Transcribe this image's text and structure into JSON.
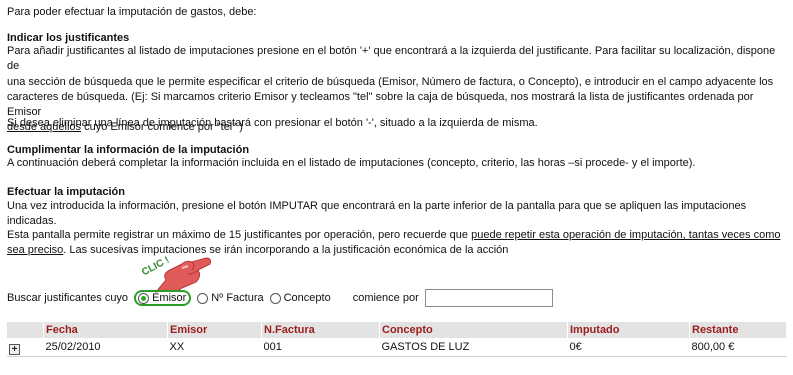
{
  "intro": "Para poder efectuar la imputación de gastos, debe:",
  "sections": {
    "indicar": {
      "heading": "Indicar los justificantes",
      "line1": "Para añadir justificantes al listado de imputaciones presione en el botón '+' que encontrará a la izquierda del justificante. Para facilitar su localización, dispone de",
      "line2": "una sección de búsqueda que le permite especificar el criterio de búsqueda (Emisor, Número de factura, o Concepto), e introducir en el campo adyacente los",
      "line3": "caracteres de búsqueda. (Ej: Si marcamos criterio Emisor y tecleamos \"tel\" sobre la caja de búsqueda, nos mostrará la lista de justificantes ordenada por Emisor",
      "line4_underlined": "desde aquellos",
      "line4_rest": " cuyo Emisor comience por \"tel\" )",
      "eliminar": "Si desea eliminar una línea de imputación bastará con presionar el botón '-', situado a la izquierda de misma."
    },
    "cumplimentar": {
      "heading": "Cumplimentar la información de la imputación",
      "text": "A continuación deberá completar la información incluida en el listado de imputaciones (concepto, criterio, las horas –si procede- y el importe)."
    },
    "efectuar": {
      "heading": "Efectuar la imputación",
      "text": "Una vez introducida la información, presione el botón IMPUTAR que encontrará en la parte inferior de la pantalla para que se apliquen las imputaciones indicadas."
    },
    "pantalla": {
      "line1_start": "Esta pantalla permite registrar un máximo de 15 justificantes por operación, pero recuerde que ",
      "line1_underlined": "puede repetir esta operación de imputación, tantas veces como",
      "line2_underlined": "sea preciso",
      "line2_rest": ". Las sucesivas imputaciones se irán incorporando a la justificación económica de la acción"
    }
  },
  "annotation": {
    "clic_label": "CLIC !",
    "colors": {
      "pointer": "#e05a5a",
      "label": "#2e8b2e"
    }
  },
  "search": {
    "label": "Buscar justificantes cuyo",
    "options": [
      "Emisor",
      "Nº Factura",
      "Concepto"
    ],
    "selected": "Emisor",
    "suffix_label": "comience por",
    "input_value": ""
  },
  "table": {
    "headers": [
      "",
      "Fecha",
      "Emisor",
      "N.Factura",
      "Concepto",
      "Imputado",
      "Restante"
    ],
    "rows": [
      {
        "add_icon": "+",
        "fecha": "25/02/2010",
        "emisor": "XX",
        "factura": "001",
        "concepto": "GASTOS DE LUZ",
        "imputado": "0€",
        "restante": "800,00 €"
      }
    ]
  },
  "colors": {
    "header_text": "#9b1c1c",
    "header_bg": "#e3e3e3",
    "radio_highlight": "#2c9c2c"
  }
}
